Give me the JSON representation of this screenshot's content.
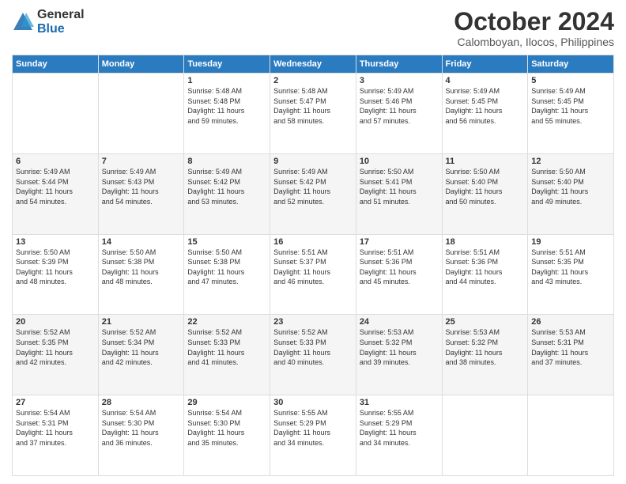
{
  "logo": {
    "general": "General",
    "blue": "Blue"
  },
  "title": "October 2024",
  "subtitle": "Calomboyan, Ilocos, Philippines",
  "headers": [
    "Sunday",
    "Monday",
    "Tuesday",
    "Wednesday",
    "Thursday",
    "Friday",
    "Saturday"
  ],
  "weeks": [
    [
      {
        "day": "",
        "info": ""
      },
      {
        "day": "",
        "info": ""
      },
      {
        "day": "1",
        "info": "Sunrise: 5:48 AM\nSunset: 5:48 PM\nDaylight: 11 hours\nand 59 minutes."
      },
      {
        "day": "2",
        "info": "Sunrise: 5:48 AM\nSunset: 5:47 PM\nDaylight: 11 hours\nand 58 minutes."
      },
      {
        "day": "3",
        "info": "Sunrise: 5:49 AM\nSunset: 5:46 PM\nDaylight: 11 hours\nand 57 minutes."
      },
      {
        "day": "4",
        "info": "Sunrise: 5:49 AM\nSunset: 5:45 PM\nDaylight: 11 hours\nand 56 minutes."
      },
      {
        "day": "5",
        "info": "Sunrise: 5:49 AM\nSunset: 5:45 PM\nDaylight: 11 hours\nand 55 minutes."
      }
    ],
    [
      {
        "day": "6",
        "info": "Sunrise: 5:49 AM\nSunset: 5:44 PM\nDaylight: 11 hours\nand 54 minutes."
      },
      {
        "day": "7",
        "info": "Sunrise: 5:49 AM\nSunset: 5:43 PM\nDaylight: 11 hours\nand 54 minutes."
      },
      {
        "day": "8",
        "info": "Sunrise: 5:49 AM\nSunset: 5:42 PM\nDaylight: 11 hours\nand 53 minutes."
      },
      {
        "day": "9",
        "info": "Sunrise: 5:49 AM\nSunset: 5:42 PM\nDaylight: 11 hours\nand 52 minutes."
      },
      {
        "day": "10",
        "info": "Sunrise: 5:50 AM\nSunset: 5:41 PM\nDaylight: 11 hours\nand 51 minutes."
      },
      {
        "day": "11",
        "info": "Sunrise: 5:50 AM\nSunset: 5:40 PM\nDaylight: 11 hours\nand 50 minutes."
      },
      {
        "day": "12",
        "info": "Sunrise: 5:50 AM\nSunset: 5:40 PM\nDaylight: 11 hours\nand 49 minutes."
      }
    ],
    [
      {
        "day": "13",
        "info": "Sunrise: 5:50 AM\nSunset: 5:39 PM\nDaylight: 11 hours\nand 48 minutes."
      },
      {
        "day": "14",
        "info": "Sunrise: 5:50 AM\nSunset: 5:38 PM\nDaylight: 11 hours\nand 48 minutes."
      },
      {
        "day": "15",
        "info": "Sunrise: 5:50 AM\nSunset: 5:38 PM\nDaylight: 11 hours\nand 47 minutes."
      },
      {
        "day": "16",
        "info": "Sunrise: 5:51 AM\nSunset: 5:37 PM\nDaylight: 11 hours\nand 46 minutes."
      },
      {
        "day": "17",
        "info": "Sunrise: 5:51 AM\nSunset: 5:36 PM\nDaylight: 11 hours\nand 45 minutes."
      },
      {
        "day": "18",
        "info": "Sunrise: 5:51 AM\nSunset: 5:36 PM\nDaylight: 11 hours\nand 44 minutes."
      },
      {
        "day": "19",
        "info": "Sunrise: 5:51 AM\nSunset: 5:35 PM\nDaylight: 11 hours\nand 43 minutes."
      }
    ],
    [
      {
        "day": "20",
        "info": "Sunrise: 5:52 AM\nSunset: 5:35 PM\nDaylight: 11 hours\nand 42 minutes."
      },
      {
        "day": "21",
        "info": "Sunrise: 5:52 AM\nSunset: 5:34 PM\nDaylight: 11 hours\nand 42 minutes."
      },
      {
        "day": "22",
        "info": "Sunrise: 5:52 AM\nSunset: 5:33 PM\nDaylight: 11 hours\nand 41 minutes."
      },
      {
        "day": "23",
        "info": "Sunrise: 5:52 AM\nSunset: 5:33 PM\nDaylight: 11 hours\nand 40 minutes."
      },
      {
        "day": "24",
        "info": "Sunrise: 5:53 AM\nSunset: 5:32 PM\nDaylight: 11 hours\nand 39 minutes."
      },
      {
        "day": "25",
        "info": "Sunrise: 5:53 AM\nSunset: 5:32 PM\nDaylight: 11 hours\nand 38 minutes."
      },
      {
        "day": "26",
        "info": "Sunrise: 5:53 AM\nSunset: 5:31 PM\nDaylight: 11 hours\nand 37 minutes."
      }
    ],
    [
      {
        "day": "27",
        "info": "Sunrise: 5:54 AM\nSunset: 5:31 PM\nDaylight: 11 hours\nand 37 minutes."
      },
      {
        "day": "28",
        "info": "Sunrise: 5:54 AM\nSunset: 5:30 PM\nDaylight: 11 hours\nand 36 minutes."
      },
      {
        "day": "29",
        "info": "Sunrise: 5:54 AM\nSunset: 5:30 PM\nDaylight: 11 hours\nand 35 minutes."
      },
      {
        "day": "30",
        "info": "Sunrise: 5:55 AM\nSunset: 5:29 PM\nDaylight: 11 hours\nand 34 minutes."
      },
      {
        "day": "31",
        "info": "Sunrise: 5:55 AM\nSunset: 5:29 PM\nDaylight: 11 hours\nand 34 minutes."
      },
      {
        "day": "",
        "info": ""
      },
      {
        "day": "",
        "info": ""
      }
    ]
  ]
}
